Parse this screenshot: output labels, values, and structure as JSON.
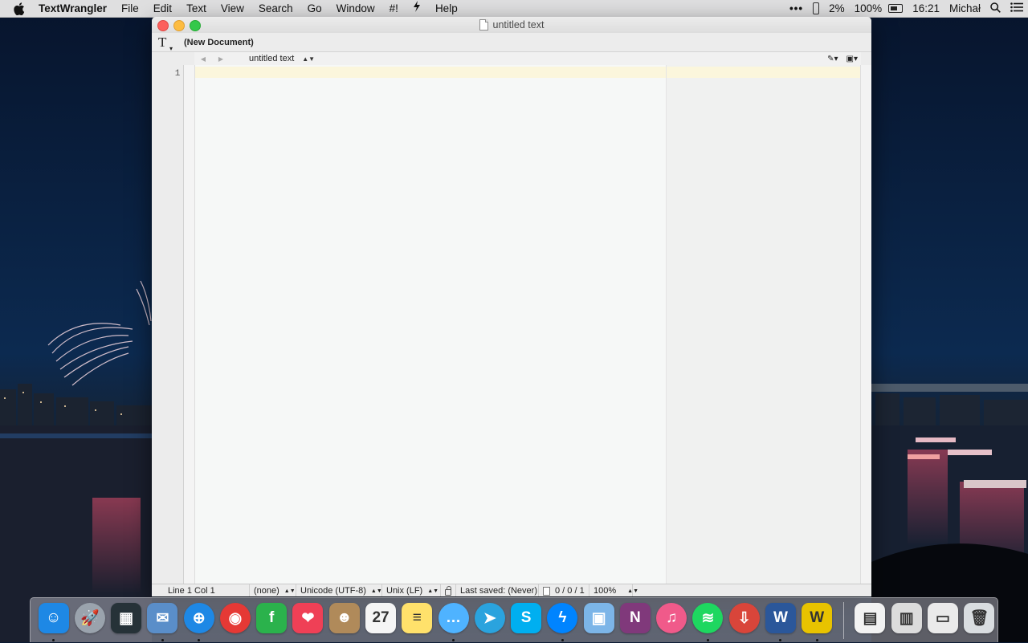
{
  "menubar": {
    "app_name": "TextWrangler",
    "menus": [
      "File",
      "Edit",
      "Text",
      "View",
      "Search",
      "Go",
      "Window",
      "#!",
      "",
      "Help"
    ],
    "status": {
      "battery_phone_percent": "2%",
      "battery_percent": "100%",
      "time": "16:21",
      "user": "Michał"
    }
  },
  "window": {
    "title": "untitled text",
    "toolbar": {
      "document_label": "(New Document)"
    },
    "navbar": {
      "document_name": "untitled text"
    },
    "gutter": {
      "line_number": "1"
    },
    "statusbar": {
      "position": "Line 1 Col 1",
      "language": "(none)",
      "encoding": "Unicode (UTF-8)",
      "line_endings": "Unix (LF)",
      "last_saved": "Last saved: (Never)",
      "counts": "0 / 0 / 1",
      "zoom": "100%"
    }
  },
  "dock": {
    "items": [
      {
        "name": "finder",
        "color": "#1e88e5",
        "glyph": "☺",
        "running": true
      },
      {
        "name": "launchpad",
        "color": "#9aa3ad",
        "glyph": "🚀",
        "running": false
      },
      {
        "name": "photos-frame",
        "color": "#263238",
        "glyph": "▦",
        "running": false
      },
      {
        "name": "mail",
        "color": "#5a8ec9",
        "glyph": "✉",
        "running": true
      },
      {
        "name": "safari",
        "color": "#1e88e5",
        "glyph": "⊕",
        "running": true
      },
      {
        "name": "chrome",
        "color": "#e53935",
        "glyph": "◉",
        "running": false
      },
      {
        "name": "feedly",
        "color": "#2bb24c",
        "glyph": "f",
        "running": false
      },
      {
        "name": "pocket",
        "color": "#ef4056",
        "glyph": "❤",
        "running": false
      },
      {
        "name": "contacts",
        "color": "#b08a5a",
        "glyph": "☻",
        "running": false
      },
      {
        "name": "calendar",
        "color": "#f5f5f5",
        "glyph": "27",
        "running": false
      },
      {
        "name": "notes",
        "color": "#ffe16b",
        "glyph": "≡",
        "running": false
      },
      {
        "name": "messages",
        "color": "#4fb3ff",
        "glyph": "…",
        "running": true
      },
      {
        "name": "telegram",
        "color": "#2aa3de",
        "glyph": "➤",
        "running": false
      },
      {
        "name": "skype",
        "color": "#00aff0",
        "glyph": "S",
        "running": false
      },
      {
        "name": "messenger",
        "color": "#0084ff",
        "glyph": "ϟ",
        "running": true
      },
      {
        "name": "preview",
        "color": "#7cb5e8",
        "glyph": "▣",
        "running": false
      },
      {
        "name": "onenote",
        "color": "#80397b",
        "glyph": "N",
        "running": false
      },
      {
        "name": "itunes",
        "color": "#f05a8a",
        "glyph": "♫",
        "running": false
      },
      {
        "name": "spotify",
        "color": "#1ed760",
        "glyph": "≋",
        "running": true
      },
      {
        "name": "transmission",
        "color": "#d9453a",
        "glyph": "⇩",
        "running": false
      },
      {
        "name": "word",
        "color": "#2b579a",
        "glyph": "W",
        "running": true
      },
      {
        "name": "textwrangler",
        "color": "#e8c300",
        "glyph": "W",
        "running": true
      },
      {
        "name": "document-1",
        "color": "#f2f2f2",
        "glyph": "▤",
        "running": false
      },
      {
        "name": "document-2",
        "color": "#dcdcdc",
        "glyph": "▥",
        "running": false
      },
      {
        "name": "document-3",
        "color": "#eaeaea",
        "glyph": "▭",
        "running": false
      },
      {
        "name": "trash",
        "color": "#d9dde0",
        "glyph": "🗑",
        "running": false
      }
    ]
  }
}
